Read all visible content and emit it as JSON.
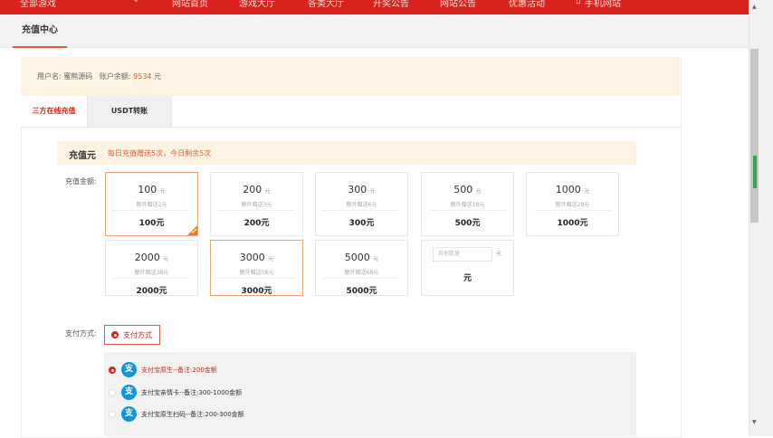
{
  "top_nav": {
    "items": [
      "全部游戏",
      "网站首页",
      "游戏大厅",
      "各类大厅",
      "开奖公告",
      "网站公告",
      "优惠活动",
      "手机网站"
    ]
  },
  "header": {
    "tab": "充值中心"
  },
  "user": {
    "username_label": "用户名:",
    "username": "蜜熊源码",
    "balance_label": "账户余额:",
    "balance": "9534",
    "balance_unit": "元"
  },
  "tabs": {
    "online": "三方在线充值",
    "usdt": "USDT转账"
  },
  "notice": {
    "title": "充值元",
    "message": "每日充值赠送5次，今日剩余5次"
  },
  "amount_label": "充值金额:",
  "amount_unit": "元",
  "cards": [
    {
      "amount": "100",
      "bonus": "额外赠送2元",
      "total": "100元"
    },
    {
      "amount": "200",
      "bonus": "额外赠送3元",
      "total": "200元"
    },
    {
      "amount": "300",
      "bonus": "额外赠送6元",
      "total": "300元"
    },
    {
      "amount": "500",
      "bonus": "额外赠送18元",
      "total": "500元"
    },
    {
      "amount": "1000",
      "bonus": "额外赠送28元",
      "total": "1000元"
    },
    {
      "amount": "2000",
      "bonus": "额外赠送38元",
      "total": "2000元"
    },
    {
      "amount": "3000",
      "bonus": "额外赠送58元",
      "total": "3000元"
    },
    {
      "amount": "5000",
      "bonus": "额外赠送68元",
      "total": "5000元"
    }
  ],
  "custom": {
    "placeholder": "其他数量",
    "unit": "元",
    "total": "元"
  },
  "payment": {
    "label": "支付方式:",
    "method_button": "支付方式",
    "options": [
      "支付宝原生--备注:200金额",
      "支付宝亲情卡--备注:300-1000金额",
      "支付宝原生扫码--备注:200-300金额"
    ],
    "alipay_glyph": "支"
  },
  "colors": {
    "brand_red": "#d9221c",
    "accent_orange": "#e05b3a",
    "alipay_blue": "#1296db"
  }
}
